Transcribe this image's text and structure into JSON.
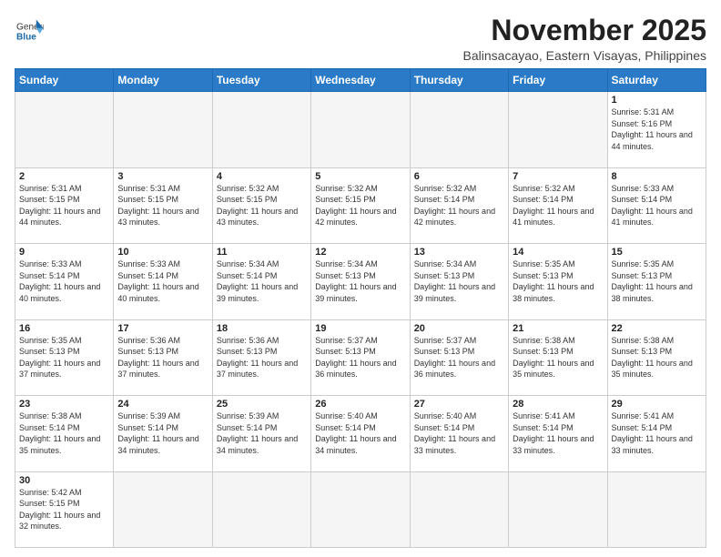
{
  "header": {
    "logo_general": "General",
    "logo_blue": "Blue",
    "month_title": "November 2025",
    "location": "Balinsacayao, Eastern Visayas, Philippines"
  },
  "weekdays": [
    "Sunday",
    "Monday",
    "Tuesday",
    "Wednesday",
    "Thursday",
    "Friday",
    "Saturday"
  ],
  "weeks": [
    [
      {
        "day": "",
        "sunrise": "",
        "sunset": "",
        "daylight": "",
        "empty": true
      },
      {
        "day": "",
        "sunrise": "",
        "sunset": "",
        "daylight": "",
        "empty": true
      },
      {
        "day": "",
        "sunrise": "",
        "sunset": "",
        "daylight": "",
        "empty": true
      },
      {
        "day": "",
        "sunrise": "",
        "sunset": "",
        "daylight": "",
        "empty": true
      },
      {
        "day": "",
        "sunrise": "",
        "sunset": "",
        "daylight": "",
        "empty": true
      },
      {
        "day": "",
        "sunrise": "",
        "sunset": "",
        "daylight": "",
        "empty": true
      },
      {
        "day": "1",
        "sunrise": "Sunrise: 5:31 AM",
        "sunset": "Sunset: 5:16 PM",
        "daylight": "Daylight: 11 hours and 44 minutes.",
        "empty": false
      }
    ],
    [
      {
        "day": "2",
        "sunrise": "Sunrise: 5:31 AM",
        "sunset": "Sunset: 5:15 PM",
        "daylight": "Daylight: 11 hours and 44 minutes.",
        "empty": false
      },
      {
        "day": "3",
        "sunrise": "Sunrise: 5:31 AM",
        "sunset": "Sunset: 5:15 PM",
        "daylight": "Daylight: 11 hours and 43 minutes.",
        "empty": false
      },
      {
        "day": "4",
        "sunrise": "Sunrise: 5:32 AM",
        "sunset": "Sunset: 5:15 PM",
        "daylight": "Daylight: 11 hours and 43 minutes.",
        "empty": false
      },
      {
        "day": "5",
        "sunrise": "Sunrise: 5:32 AM",
        "sunset": "Sunset: 5:15 PM",
        "daylight": "Daylight: 11 hours and 42 minutes.",
        "empty": false
      },
      {
        "day": "6",
        "sunrise": "Sunrise: 5:32 AM",
        "sunset": "Sunset: 5:14 PM",
        "daylight": "Daylight: 11 hours and 42 minutes.",
        "empty": false
      },
      {
        "day": "7",
        "sunrise": "Sunrise: 5:32 AM",
        "sunset": "Sunset: 5:14 PM",
        "daylight": "Daylight: 11 hours and 41 minutes.",
        "empty": false
      },
      {
        "day": "8",
        "sunrise": "Sunrise: 5:33 AM",
        "sunset": "Sunset: 5:14 PM",
        "daylight": "Daylight: 11 hours and 41 minutes.",
        "empty": false
      }
    ],
    [
      {
        "day": "9",
        "sunrise": "Sunrise: 5:33 AM",
        "sunset": "Sunset: 5:14 PM",
        "daylight": "Daylight: 11 hours and 40 minutes.",
        "empty": false
      },
      {
        "day": "10",
        "sunrise": "Sunrise: 5:33 AM",
        "sunset": "Sunset: 5:14 PM",
        "daylight": "Daylight: 11 hours and 40 minutes.",
        "empty": false
      },
      {
        "day": "11",
        "sunrise": "Sunrise: 5:34 AM",
        "sunset": "Sunset: 5:14 PM",
        "daylight": "Daylight: 11 hours and 39 minutes.",
        "empty": false
      },
      {
        "day": "12",
        "sunrise": "Sunrise: 5:34 AM",
        "sunset": "Sunset: 5:13 PM",
        "daylight": "Daylight: 11 hours and 39 minutes.",
        "empty": false
      },
      {
        "day": "13",
        "sunrise": "Sunrise: 5:34 AM",
        "sunset": "Sunset: 5:13 PM",
        "daylight": "Daylight: 11 hours and 39 minutes.",
        "empty": false
      },
      {
        "day": "14",
        "sunrise": "Sunrise: 5:35 AM",
        "sunset": "Sunset: 5:13 PM",
        "daylight": "Daylight: 11 hours and 38 minutes.",
        "empty": false
      },
      {
        "day": "15",
        "sunrise": "Sunrise: 5:35 AM",
        "sunset": "Sunset: 5:13 PM",
        "daylight": "Daylight: 11 hours and 38 minutes.",
        "empty": false
      }
    ],
    [
      {
        "day": "16",
        "sunrise": "Sunrise: 5:35 AM",
        "sunset": "Sunset: 5:13 PM",
        "daylight": "Daylight: 11 hours and 37 minutes.",
        "empty": false
      },
      {
        "day": "17",
        "sunrise": "Sunrise: 5:36 AM",
        "sunset": "Sunset: 5:13 PM",
        "daylight": "Daylight: 11 hours and 37 minutes.",
        "empty": false
      },
      {
        "day": "18",
        "sunrise": "Sunrise: 5:36 AM",
        "sunset": "Sunset: 5:13 PM",
        "daylight": "Daylight: 11 hours and 37 minutes.",
        "empty": false
      },
      {
        "day": "19",
        "sunrise": "Sunrise: 5:37 AM",
        "sunset": "Sunset: 5:13 PM",
        "daylight": "Daylight: 11 hours and 36 minutes.",
        "empty": false
      },
      {
        "day": "20",
        "sunrise": "Sunrise: 5:37 AM",
        "sunset": "Sunset: 5:13 PM",
        "daylight": "Daylight: 11 hours and 36 minutes.",
        "empty": false
      },
      {
        "day": "21",
        "sunrise": "Sunrise: 5:38 AM",
        "sunset": "Sunset: 5:13 PM",
        "daylight": "Daylight: 11 hours and 35 minutes.",
        "empty": false
      },
      {
        "day": "22",
        "sunrise": "Sunrise: 5:38 AM",
        "sunset": "Sunset: 5:13 PM",
        "daylight": "Daylight: 11 hours and 35 minutes.",
        "empty": false
      }
    ],
    [
      {
        "day": "23",
        "sunrise": "Sunrise: 5:38 AM",
        "sunset": "Sunset: 5:14 PM",
        "daylight": "Daylight: 11 hours and 35 minutes.",
        "empty": false
      },
      {
        "day": "24",
        "sunrise": "Sunrise: 5:39 AM",
        "sunset": "Sunset: 5:14 PM",
        "daylight": "Daylight: 11 hours and 34 minutes.",
        "empty": false
      },
      {
        "day": "25",
        "sunrise": "Sunrise: 5:39 AM",
        "sunset": "Sunset: 5:14 PM",
        "daylight": "Daylight: 11 hours and 34 minutes.",
        "empty": false
      },
      {
        "day": "26",
        "sunrise": "Sunrise: 5:40 AM",
        "sunset": "Sunset: 5:14 PM",
        "daylight": "Daylight: 11 hours and 34 minutes.",
        "empty": false
      },
      {
        "day": "27",
        "sunrise": "Sunrise: 5:40 AM",
        "sunset": "Sunset: 5:14 PM",
        "daylight": "Daylight: 11 hours and 33 minutes.",
        "empty": false
      },
      {
        "day": "28",
        "sunrise": "Sunrise: 5:41 AM",
        "sunset": "Sunset: 5:14 PM",
        "daylight": "Daylight: 11 hours and 33 minutes.",
        "empty": false
      },
      {
        "day": "29",
        "sunrise": "Sunrise: 5:41 AM",
        "sunset": "Sunset: 5:14 PM",
        "daylight": "Daylight: 11 hours and 33 minutes.",
        "empty": false
      }
    ],
    [
      {
        "day": "30",
        "sunrise": "Sunrise: 5:42 AM",
        "sunset": "Sunset: 5:15 PM",
        "daylight": "Daylight: 11 hours and 32 minutes.",
        "empty": false
      },
      {
        "day": "",
        "sunrise": "",
        "sunset": "",
        "daylight": "",
        "empty": true
      },
      {
        "day": "",
        "sunrise": "",
        "sunset": "",
        "daylight": "",
        "empty": true
      },
      {
        "day": "",
        "sunrise": "",
        "sunset": "",
        "daylight": "",
        "empty": true
      },
      {
        "day": "",
        "sunrise": "",
        "sunset": "",
        "daylight": "",
        "empty": true
      },
      {
        "day": "",
        "sunrise": "",
        "sunset": "",
        "daylight": "",
        "empty": true
      },
      {
        "day": "",
        "sunrise": "",
        "sunset": "",
        "daylight": "",
        "empty": true
      }
    ]
  ]
}
